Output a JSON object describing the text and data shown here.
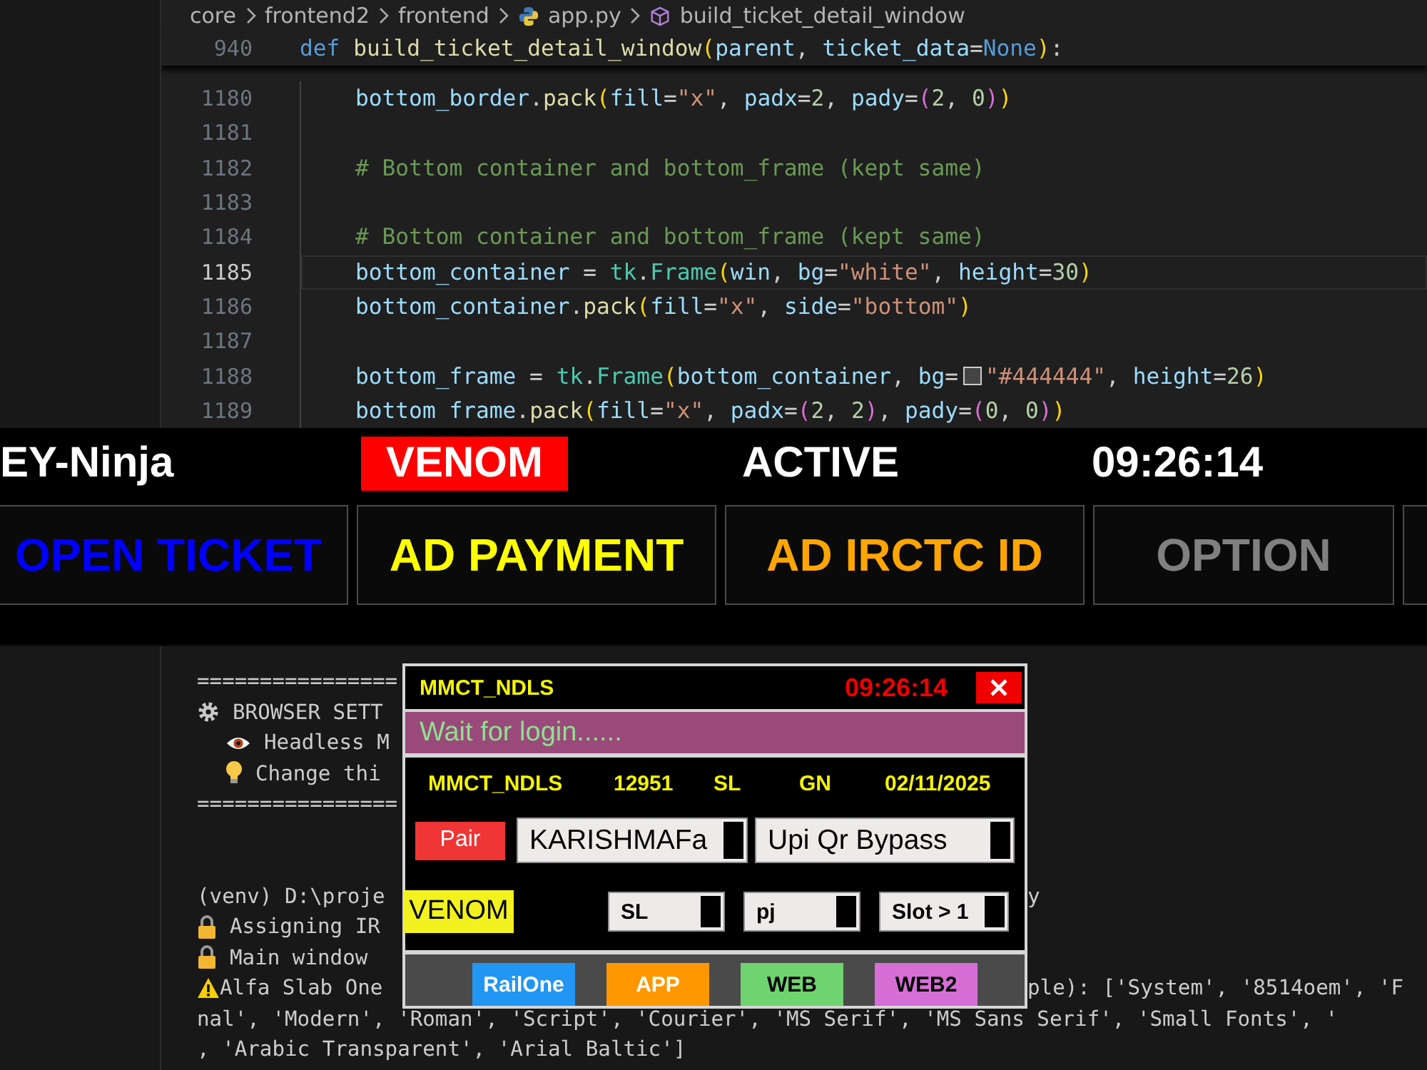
{
  "editor": {
    "breadcrumb": [
      {
        "kind": "folder",
        "label": "core"
      },
      {
        "kind": "folder",
        "label": "frontend2"
      },
      {
        "kind": "folder",
        "label": "frontend"
      },
      {
        "kind": "python-file",
        "label": "app.py"
      },
      {
        "kind": "symbol",
        "label": "build_ticket_detail_window"
      }
    ],
    "sticky_line": {
      "number": "940",
      "tokens": [
        {
          "kind": "kw",
          "text": "def "
        },
        {
          "kind": "fn",
          "text": "build_ticket_detail_window"
        },
        {
          "kind": "b1",
          "text": "("
        },
        {
          "kind": "var",
          "text": "parent"
        },
        {
          "kind": "p",
          "text": ", "
        },
        {
          "kind": "var",
          "text": "ticket_data"
        },
        {
          "kind": "p",
          "text": "="
        },
        {
          "kind": "kw",
          "text": "None"
        },
        {
          "kind": "b1",
          "text": ")"
        },
        {
          "kind": "p",
          "text": ":"
        }
      ]
    },
    "lines": [
      {
        "number": "1180",
        "current": false,
        "tokens": [
          {
            "kind": "var",
            "text": "bottom_border"
          },
          {
            "kind": "p",
            "text": "."
          },
          {
            "kind": "fn",
            "text": "pack"
          },
          {
            "kind": "b1",
            "text": "("
          },
          {
            "kind": "var",
            "text": "fill"
          },
          {
            "kind": "p",
            "text": "="
          },
          {
            "kind": "str",
            "text": "\"x\""
          },
          {
            "kind": "p",
            "text": ", "
          },
          {
            "kind": "var",
            "text": "padx"
          },
          {
            "kind": "p",
            "text": "="
          },
          {
            "kind": "num",
            "text": "2"
          },
          {
            "kind": "p",
            "text": ", "
          },
          {
            "kind": "var",
            "text": "pady"
          },
          {
            "kind": "p",
            "text": "="
          },
          {
            "kind": "b2",
            "text": "("
          },
          {
            "kind": "num",
            "text": "2"
          },
          {
            "kind": "p",
            "text": ", "
          },
          {
            "kind": "num",
            "text": "0"
          },
          {
            "kind": "b2",
            "text": ")"
          },
          {
            "kind": "b1",
            "text": ")"
          }
        ]
      },
      {
        "number": "1181",
        "current": false
      },
      {
        "number": "1182",
        "current": false,
        "tokens": [
          {
            "kind": "cm",
            "text": "# Bottom container and bottom_frame (kept same)"
          }
        ]
      },
      {
        "number": "1183",
        "current": false
      },
      {
        "number": "1184",
        "current": false,
        "tokens": [
          {
            "kind": "cm",
            "text": "# Bottom container and bottom_frame (kept same)"
          }
        ]
      },
      {
        "number": "1185",
        "current": true,
        "tokens": [
          {
            "kind": "var",
            "text": "bottom_container"
          },
          {
            "kind": "p",
            "text": " = "
          },
          {
            "kind": "cls",
            "text": "tk"
          },
          {
            "kind": "p",
            "text": "."
          },
          {
            "kind": "cls",
            "text": "Frame"
          },
          {
            "kind": "b1",
            "text": "("
          },
          {
            "kind": "var",
            "text": "win"
          },
          {
            "kind": "p",
            "text": ", "
          },
          {
            "kind": "var",
            "text": "bg"
          },
          {
            "kind": "p",
            "text": "="
          },
          {
            "kind": "str",
            "text": "\"white\""
          },
          {
            "kind": "p",
            "text": ", "
          },
          {
            "kind": "var",
            "text": "height"
          },
          {
            "kind": "p",
            "text": "="
          },
          {
            "kind": "num",
            "text": "30"
          },
          {
            "kind": "b1",
            "text": ")"
          }
        ]
      },
      {
        "number": "1186",
        "current": false,
        "tokens": [
          {
            "kind": "var",
            "text": "bottom_container"
          },
          {
            "kind": "p",
            "text": "."
          },
          {
            "kind": "fn",
            "text": "pack"
          },
          {
            "kind": "b1",
            "text": "("
          },
          {
            "kind": "var",
            "text": "fill"
          },
          {
            "kind": "p",
            "text": "="
          },
          {
            "kind": "str",
            "text": "\"x\""
          },
          {
            "kind": "p",
            "text": ", "
          },
          {
            "kind": "var",
            "text": "side"
          },
          {
            "kind": "p",
            "text": "="
          },
          {
            "kind": "str",
            "text": "\"bottom\""
          },
          {
            "kind": "b1",
            "text": ")"
          }
        ]
      },
      {
        "number": "1187",
        "current": false
      },
      {
        "number": "1188",
        "current": false,
        "tokens": [
          {
            "kind": "var",
            "text": "bottom_frame"
          },
          {
            "kind": "p",
            "text": " = "
          },
          {
            "kind": "cls",
            "text": "tk"
          },
          {
            "kind": "p",
            "text": "."
          },
          {
            "kind": "cls",
            "text": "Frame"
          },
          {
            "kind": "b1",
            "text": "("
          },
          {
            "kind": "var",
            "text": "bottom_container"
          },
          {
            "kind": "p",
            "text": ", "
          },
          {
            "kind": "var",
            "text": "bg"
          },
          {
            "kind": "p",
            "text": "="
          },
          {
            "kind": "swatch",
            "color": "#444444"
          },
          {
            "kind": "str",
            "text": "\"#444444\""
          },
          {
            "kind": "p",
            "text": ", "
          },
          {
            "kind": "var",
            "text": "height"
          },
          {
            "kind": "p",
            "text": "="
          },
          {
            "kind": "num",
            "text": "26"
          },
          {
            "kind": "b1",
            "text": ")"
          }
        ]
      },
      {
        "number": "1189",
        "current": false,
        "tokens": [
          {
            "kind": "var",
            "text": "bottom frame"
          },
          {
            "kind": "p",
            "text": "."
          },
          {
            "kind": "fn",
            "text": "pack"
          },
          {
            "kind": "b1",
            "text": "("
          },
          {
            "kind": "var",
            "text": "fill"
          },
          {
            "kind": "p",
            "text": "="
          },
          {
            "kind": "str",
            "text": "\"x\""
          },
          {
            "kind": "p",
            "text": ", "
          },
          {
            "kind": "var",
            "text": "padx"
          },
          {
            "kind": "p",
            "text": "="
          },
          {
            "kind": "b2",
            "text": "("
          },
          {
            "kind": "num",
            "text": "2"
          },
          {
            "kind": "p",
            "text": ", "
          },
          {
            "kind": "num",
            "text": "2"
          },
          {
            "kind": "b2",
            "text": ")"
          },
          {
            "kind": "p",
            "text": ", "
          },
          {
            "kind": "var",
            "text": "pady"
          },
          {
            "kind": "p",
            "text": "="
          },
          {
            "kind": "b2",
            "text": "("
          },
          {
            "kind": "num",
            "text": "0"
          },
          {
            "kind": "p",
            "text": ", "
          },
          {
            "kind": "num",
            "text": "0"
          },
          {
            "kind": "b2",
            "text": ")"
          },
          {
            "kind": "b1",
            "text": ")"
          }
        ]
      }
    ]
  },
  "app_bar": {
    "name": "EY-Ninja",
    "badge": "VENOM",
    "status": "ACTIVE",
    "clock": "09:26:14",
    "buttons": [
      {
        "label": "OPEN TICKET",
        "color": "#0000ff"
      },
      {
        "label": "AD PAYMENT",
        "color": "#ffff00"
      },
      {
        "label": "AD IRCTC ID",
        "color": "#ffa500"
      },
      {
        "label": "OPTION",
        "color": "#808080"
      }
    ]
  },
  "terminal": {
    "lines": [
      {
        "kind": "plain",
        "text": "================"
      },
      {
        "kind": "gear",
        "text": "BROWSER SETT"
      },
      {
        "kind": "eye",
        "text": "Headless M"
      },
      {
        "kind": "bulb",
        "text": "Change thi"
      },
      {
        "kind": "plain",
        "text": "================"
      },
      {
        "kind": "blank"
      },
      {
        "kind": "blank"
      },
      {
        "kind": "plain",
        "text": "(venv) D:\\proje",
        "right_text": "y"
      },
      {
        "kind": "lock",
        "text": "Assigning IR"
      },
      {
        "kind": "lock",
        "text": "Main window"
      },
      {
        "kind": "warning",
        "text": "Alfa Slab One",
        "right_text": "ple): ['System', '8514oem', 'F"
      },
      {
        "kind": "plain",
        "text": "nal', 'Modern', 'Roman', 'Script', 'Courier', 'MS Serif', 'MS Sans Serif', 'Small Fonts', '"
      },
      {
        "kind": "plain",
        "text": ", 'Arabic Transparent', 'Arial Baltic']"
      }
    ]
  },
  "popup": {
    "title": "MMCT_NDLS",
    "clock": "09:26:14",
    "status": "Wait for login......",
    "info": [
      "MMCT_NDLS",
      "12951",
      "SL",
      "GN",
      "02/11/2025"
    ],
    "pair_button": "Pair",
    "account_dropdowns": [
      "KARISHMAFa",
      "Upi Qr Bypass"
    ],
    "tag": "VENOM",
    "option_dropdowns": [
      "SL",
      "pj",
      "Slot > 1"
    ],
    "buttons": [
      {
        "kind": "light-label",
        "label": "RailOne",
        "color": "#2196f3"
      },
      {
        "kind": "light-label",
        "label": "APP",
        "color": "#ff9800"
      },
      {
        "kind": "dark-label",
        "label": "WEB",
        "color": "#6fd46f"
      },
      {
        "kind": "dark-label",
        "label": "WEB2",
        "color": "#d56fd5"
      }
    ]
  }
}
